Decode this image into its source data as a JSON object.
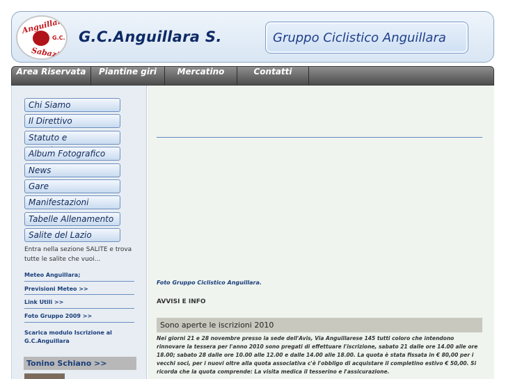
{
  "header": {
    "logo": {
      "top_text": "Anguillara",
      "bottom_text": "Sabazia",
      "badge": "G.C."
    },
    "site_title": "G.C.Anguillara S.",
    "box_title": "Gruppo Ciclistico Anguillara"
  },
  "nav": {
    "items": [
      "Area Riservata",
      "Piantine giri",
      "Mercatino",
      "Contatti"
    ]
  },
  "sidebar": {
    "menu": [
      "Chi Siamo",
      "Il Direttivo",
      "Statuto e Regolamento",
      "Album Fotografico",
      "News",
      "Gare",
      "Manifestazioni",
      "Tabelle Allenamento",
      "Salite del Lazio"
    ],
    "note": "Entra nella sezione SALITE e trova tutte le salite che vuoi...",
    "links": [
      "Meteo Anguillara;",
      "Previsioni Meteo >>",
      "Link Utili >>",
      "Foto Gruppo 2009 >>",
      "Scarica modulo Iscrizione al G.C.Anguillara"
    ],
    "heading": "Tonino Schiano >>"
  },
  "main": {
    "caption": "Foto Gruppo Ciclistico Anguillara.",
    "section_title": "AVVISI E INFO",
    "news_title": "Sono aperte le iscrizioni 2010",
    "news_body": "Nei giorni 21 e 28 novembre presso la sede dell'Avis, Via Anguillarese 145 tutti coloro che intendono rinnovare la tessera per l'anno 2010 sono pregati di effettuare l'iscrizione, sabato 21 dalle ore 14.00 alle ore 18.00; sabato 28 dalle ore 10.00 alle 12.00 e dalle 14.00 alle 18.00. La quota è stata fissata in € 80,00 per i vecchi soci, per i nuovi oltre alla quota associativa c'è l'obbligo di acquistare il completino estivo € 50,00. Si ricorda che la quota comprende: La visita medica il tesserino e l'assicurazione."
  },
  "colors": {
    "nav_bg": "#5a5a5a",
    "title_blue": "#0e2a66",
    "link_blue": "#1a3e7a",
    "logo_red": "#c0151b"
  }
}
